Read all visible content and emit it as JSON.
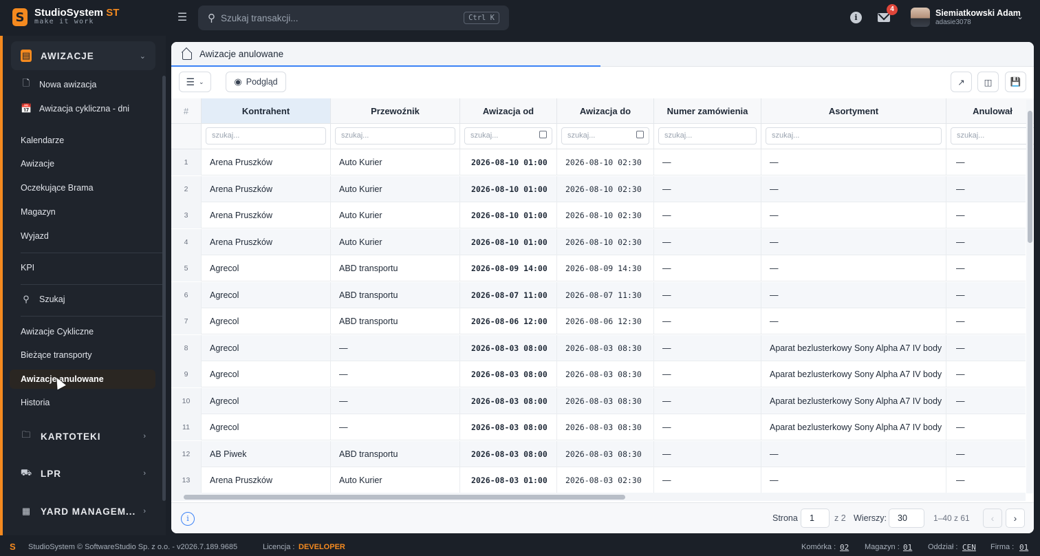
{
  "app": {
    "name": "StudioSystem",
    "name_accent": "ST",
    "tagline": "make it work",
    "logo_letter": "S"
  },
  "search": {
    "placeholder": "Szukaj transakcji...",
    "shortcut": "Ctrl K"
  },
  "header": {
    "mail_count": "4",
    "user_name": "Siemiatkowski Adam",
    "user_login": "adasie3078"
  },
  "sidebar": {
    "groups": [
      {
        "label": "AWIZACJE",
        "icon": "clipboard-icon",
        "expanded": true
      },
      {
        "label": "KARTOTEKI",
        "icon": "folder-icon"
      },
      {
        "label": "LPR",
        "icon": "truck-icon"
      },
      {
        "label": "YARD MANAGEM...",
        "icon": "grid-icon"
      }
    ],
    "items": [
      {
        "label": "Nowa awizacja",
        "icon": "file-icon"
      },
      {
        "label": "Awizacja cykliczna - dni",
        "icon": "calendar-icon"
      },
      {
        "label": "Kalendarze"
      },
      {
        "label": "Awizacje"
      },
      {
        "label": "Oczekujące Brama"
      },
      {
        "label": "Magazyn"
      },
      {
        "label": "Wyjazd"
      },
      {
        "label": "KPI"
      },
      {
        "label": "Szukaj",
        "icon": "search-icon"
      },
      {
        "label": "Awizacje Cykliczne"
      },
      {
        "label": "Bieżące transporty"
      },
      {
        "label": "Awizacje anulowane",
        "active": true
      },
      {
        "label": "Historia"
      }
    ]
  },
  "page": {
    "title": "Awizacje anulowane",
    "preview_label": "Podgląd"
  },
  "table": {
    "filter_placeholder": "szukaj...",
    "columns": [
      "#",
      "Kontrahent",
      "Przewoźnik",
      "Awizacja od",
      "Awizacja do",
      "Numer zamówienia",
      "Asortyment",
      "Anulował"
    ],
    "rows": [
      [
        "1",
        "Arena Pruszków",
        "Auto Kurier",
        "2026-08-10 01:00",
        "2026-08-10 02:30",
        "—",
        "—",
        "—"
      ],
      [
        "2",
        "Arena Pruszków",
        "Auto Kurier",
        "2026-08-10 01:00",
        "2026-08-10 02:30",
        "—",
        "—",
        "—"
      ],
      [
        "3",
        "Arena Pruszków",
        "Auto Kurier",
        "2026-08-10 01:00",
        "2026-08-10 02:30",
        "—",
        "—",
        "—"
      ],
      [
        "4",
        "Arena Pruszków",
        "Auto Kurier",
        "2026-08-10 01:00",
        "2026-08-10 02:30",
        "—",
        "—",
        "—"
      ],
      [
        "5",
        "Agrecol",
        "ABD transportu",
        "2026-08-09 14:00",
        "2026-08-09 14:30",
        "—",
        "—",
        "—"
      ],
      [
        "6",
        "Agrecol",
        "ABD transportu",
        "2026-08-07 11:00",
        "2026-08-07 11:30",
        "—",
        "—",
        "—"
      ],
      [
        "7",
        "Agrecol",
        "ABD transportu",
        "2026-08-06 12:00",
        "2026-08-06 12:30",
        "—",
        "—",
        "—"
      ],
      [
        "8",
        "Agrecol",
        "—",
        "2026-08-03 08:00",
        "2026-08-03 08:30",
        "—",
        "Aparat bezlusterkowy Sony Alpha A7 IV body",
        "—"
      ],
      [
        "9",
        "Agrecol",
        "—",
        "2026-08-03 08:00",
        "2026-08-03 08:30",
        "—",
        "Aparat bezlusterkowy Sony Alpha A7 IV body",
        "—"
      ],
      [
        "10",
        "Agrecol",
        "—",
        "2026-08-03 08:00",
        "2026-08-03 08:30",
        "—",
        "Aparat bezlusterkowy Sony Alpha A7 IV body",
        "—"
      ],
      [
        "11",
        "Agrecol",
        "—",
        "2026-08-03 08:00",
        "2026-08-03 08:30",
        "—",
        "Aparat bezlusterkowy Sony Alpha A7 IV body",
        "—"
      ],
      [
        "12",
        "AB Piwek",
        "ABD transportu",
        "2026-08-03 08:00",
        "2026-08-03 08:30",
        "—",
        "—",
        "—"
      ],
      [
        "13",
        "Arena Pruszków",
        "Auto Kurier",
        "2026-08-03 01:00",
        "2026-08-03 02:30",
        "—",
        "—",
        "—"
      ]
    ]
  },
  "pagination": {
    "page_label": "Strona",
    "page": "1",
    "of": "z 2",
    "rows_label": "Wierszy:",
    "rows": "30",
    "range": "1–40 z 61"
  },
  "status": {
    "copyright": "StudioSystem © SoftwareStudio Sp. z o.o. - v2026.7.189.9685",
    "license_label": "Licencja :",
    "license": "DEVELOPER",
    "cell_label": "Komórka :",
    "cell": "02",
    "warehouse_label": "Magazyn :",
    "warehouse": "01",
    "branch_label": "Oddział :",
    "branch": "CEN",
    "company_label": "Firma :",
    "company": "01"
  },
  "colors": {
    "accent": "#f58a1f",
    "link": "#3b82f6",
    "badge": "#e0463a"
  }
}
